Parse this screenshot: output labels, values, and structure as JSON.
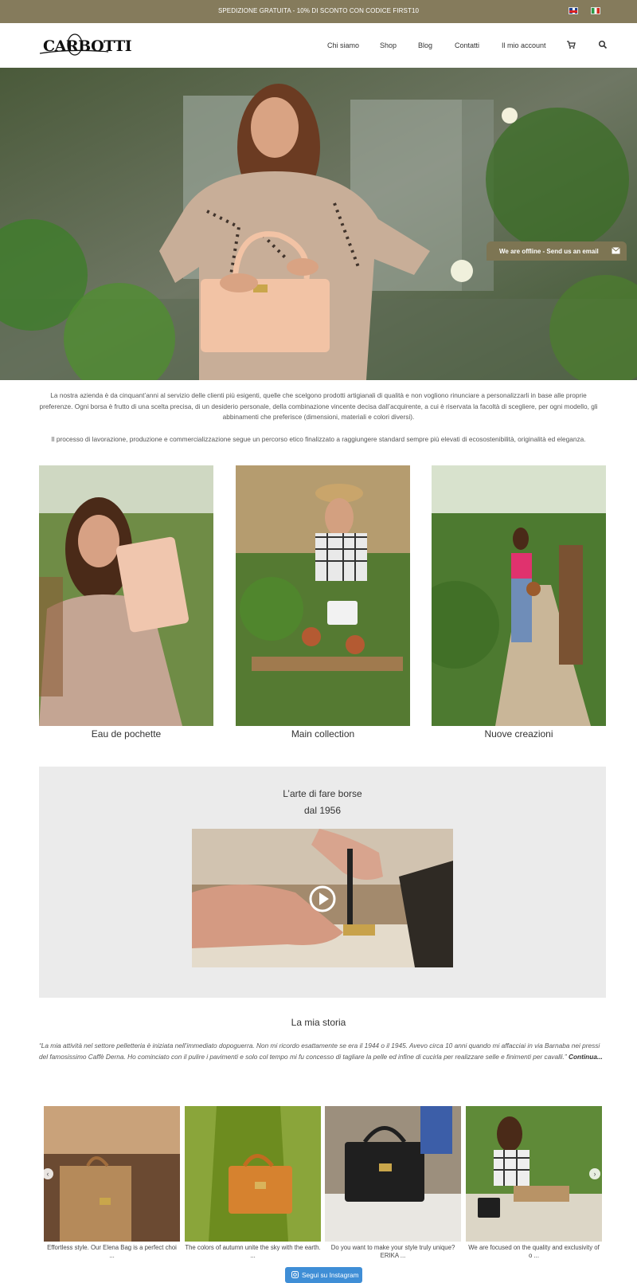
{
  "topbar": {
    "promo": "SPEDIZIONE GRATUITA - 10% DI SCONTO CON CODICE FIRST10",
    "color": "#857b5c"
  },
  "header": {
    "logo_text": "CARBOTTI",
    "nav": [
      "Chi siamo",
      "Shop",
      "Blog",
      "Contatti",
      "Il mio account"
    ],
    "icons": [
      "cart-icon",
      "search-icon"
    ]
  },
  "hero": {
    "chat_label": "We are offline - Send us an email"
  },
  "intro": {
    "p1": "La nostra azienda è da cinquant’anni al servizio delle clienti più esigenti, quelle che scelgono prodotti artigianali di qualità e non vogliono rinunciare a personalizzarli in base alle proprie preferenze.  Ogni borsa è frutto di una scelta precisa, di un desiderio personale, della combinazione vincente decisa dall’acquirente, a cui è riservata la facoltà di scegliere, per ogni modello, gli abbinamenti che preferisce (dimensioni, materiali e colori diversi).",
    "p2": "Il processo di lavorazione, produzione e commercializzazione segue un percorso etico finalizzato a raggiungere standard sempre più elevati di ecosostenibilità, originalità ed eleganza."
  },
  "collections": [
    {
      "label": "Eau de pochette"
    },
    {
      "label": "Main collection"
    },
    {
      "label": "Nuove creazioni"
    }
  ],
  "video": {
    "title_line1": "L’arte di fare borse",
    "title_line2": "dal 1956"
  },
  "story": {
    "title": "La mia storia",
    "text": "“La mia attività nel settore pelletteria è iniziata nell’immediato dopoguerra. Non mi ricordo esattamente se era il 1944 o il 1945. Avevo circa 10 anni quando mi affacciai in via Barnaba nei pressi del famosissimo Caffè Derna. Ho cominciato con il pulire i pavimenti e solo col tempo mi fu concesso di tagliare la pelle ed infine di cucirla per realizzare selle e finimenti per cavalli.”",
    "more": "Continua..."
  },
  "instagram": {
    "posts": [
      {
        "caption": "Effortless style. Our Elena Bag is a perfect choi ..."
      },
      {
        "caption": "The colors of autumn unite the sky with the earth. ..."
      },
      {
        "caption": "Do you want to make your style truly unique? ERIKA ..."
      },
      {
        "caption": "We are focused on the quality and exclusivity of o ..."
      }
    ],
    "follow_label": "Segui su Instagram",
    "follow_color": "#3f8ed6"
  }
}
